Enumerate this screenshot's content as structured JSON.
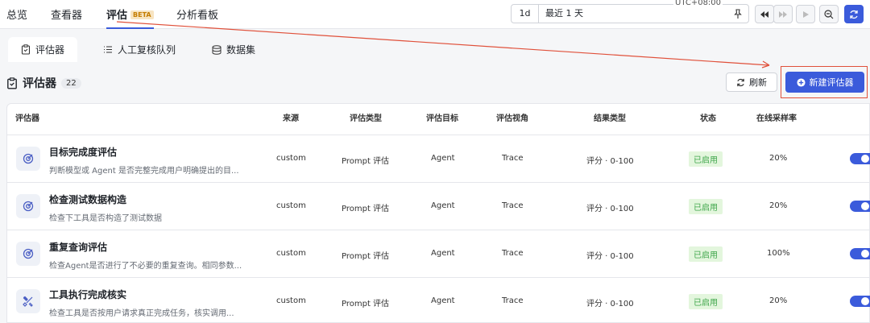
{
  "nav": {
    "tabs": [
      {
        "label": "总览"
      },
      {
        "label": "查看器"
      },
      {
        "label": "评估",
        "badge": "BETA"
      },
      {
        "label": "分析看板"
      }
    ]
  },
  "timepicker": {
    "range": "1d",
    "label": "最近 1 天",
    "timezone": "UTC+08:00"
  },
  "subtabs": [
    {
      "label": "评估器"
    },
    {
      "label": "人工复核队列"
    },
    {
      "label": "数据集"
    }
  ],
  "panel": {
    "title": "评估器",
    "count": "22",
    "refresh_label": "刷新",
    "new_label": "新建评估器"
  },
  "table": {
    "headers": [
      "评估器",
      "来源",
      "评估类型",
      "评估目标",
      "评估视角",
      "结果类型",
      "状态",
      "在线采样率"
    ],
    "rows": [
      {
        "name": "目标完成度评估",
        "desc": "判断模型或 Agent 是否完整完成用户明确提出的目...",
        "source": "custom",
        "type": "Prompt 评估",
        "target": "Agent",
        "view": "Trace",
        "result": "评分 · 0-100",
        "status": "已启用",
        "rate": "20%",
        "icon": "target-icon"
      },
      {
        "name": "检查测试数据构造",
        "desc": "检查下工具是否构造了测试数据",
        "source": "custom",
        "type": "Prompt 评估",
        "target": "Agent",
        "view": "Trace",
        "result": "评分 · 0-100",
        "status": "已启用",
        "rate": "20%",
        "icon": "target-icon"
      },
      {
        "name": "重复查询评估",
        "desc": "检查Agent是否进行了不必要的重复查询。相同参数...",
        "source": "custom",
        "type": "Prompt 评估",
        "target": "Agent",
        "view": "Trace",
        "result": "评分 · 0-100",
        "status": "已启用",
        "rate": "100%",
        "icon": "target-icon"
      },
      {
        "name": "工具执行完成核实",
        "desc": "检查工具是否按用户请求真正完成任务，核实调用...",
        "source": "custom",
        "type": "Prompt 评估",
        "target": "Agent",
        "view": "Trace",
        "result": "评分 · 0-100",
        "status": "已启用",
        "rate": "20%",
        "icon": "tools-icon"
      }
    ]
  },
  "colors": {
    "accent": "#3b5bdb",
    "success_bg": "#e3f6dd",
    "success_text": "#3fa64b",
    "annotation": "#e0503a"
  }
}
